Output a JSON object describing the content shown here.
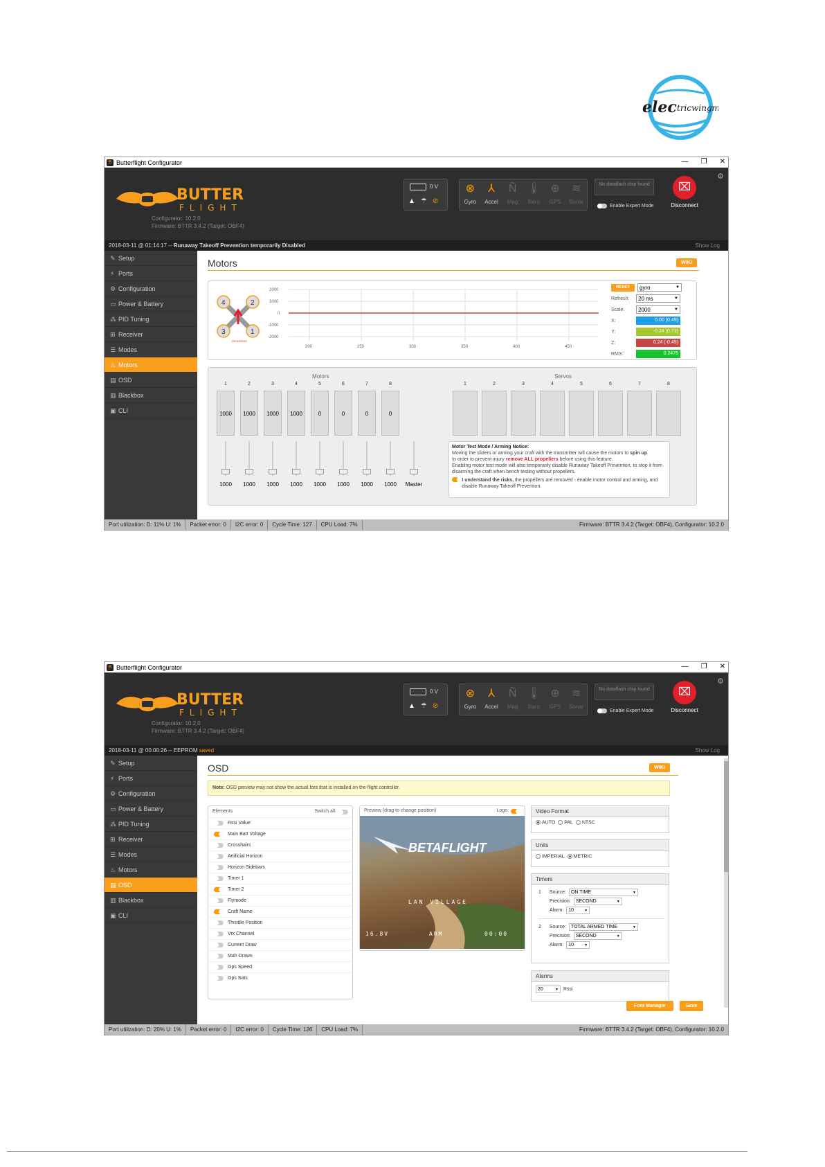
{
  "colors": {
    "accent": "#f89e1d",
    "header_bg": "#2d2d2d",
    "sidebar_bg": "#393939",
    "disconnect": "#e2202c",
    "x_bar": "#1e9ee8",
    "y_bar": "#a5c92b",
    "z_bar": "#c64545",
    "rms_bar": "#17c42b"
  },
  "brand_logo": "electricwingman",
  "app": {
    "title": "Butterflight Configurator",
    "brand_top": "BUTTER",
    "brand_bottom": "FLIGHT",
    "configurator": "Configurator: 10.2.0",
    "firmware": "Firmware: BTTR 3.4.2 (Target: OBF4)",
    "voltage": "0 V",
    "dataflash": "No dataflash chip found",
    "expert_mode": "Enable Expert Mode",
    "disconnect": "Disconnect",
    "show_log": "Show Log"
  },
  "sensors": [
    {
      "label": "Gyro",
      "icon": "gyro-icon",
      "on": true
    },
    {
      "label": "Accel",
      "icon": "accel-icon",
      "on": true
    },
    {
      "label": "Mag",
      "icon": "mag-icon",
      "on": false
    },
    {
      "label": "Baro",
      "icon": "baro-icon",
      "on": false
    },
    {
      "label": "GPS",
      "icon": "gps-icon",
      "on": false
    },
    {
      "label": "Sonar",
      "icon": "sonar-icon",
      "on": false
    }
  ],
  "sidebar": [
    "Setup",
    "Ports",
    "Configuration",
    "Power & Battery",
    "PID Tuning",
    "Receiver",
    "Modes",
    "Motors",
    "OSD",
    "Blackbox",
    "CLI"
  ],
  "status": {
    "port_util_1": "Port utilization: D: 11% U: 1%",
    "port_util_2": "Port utilization: D: 20% U: 1%",
    "packet_error": "Packet error: 0",
    "i2c_error": "I2C error: 0",
    "cycle_1": "Cycle Time: 127",
    "cycle_2": "Cycle Time: 126",
    "cpu": "CPU Load: 7%",
    "firmware": "Firmware: BTTR 3.4.2 (Target: OBF4), Configurator: 10.2.0"
  },
  "motors_screen": {
    "log_time": "2018-03-11 @ 01:14:17 --",
    "log_msg": "Runaway Takeoff Prevention temporarily Disabled",
    "title": "Motors",
    "wiki": "WIKI",
    "reversed": "REVERSED",
    "graph": {
      "y_ticks": [
        "2000",
        "1000",
        "0",
        "-1000",
        "-2000"
      ],
      "x_ticks": [
        "200",
        "250",
        "300",
        "350",
        "400",
        "450"
      ]
    },
    "controls": {
      "reset": "RESET",
      "sensor": "gyro",
      "refresh_label": "Refresh:",
      "refresh": "20 ms",
      "scale_label": "Scale:",
      "scale": "2000",
      "x_label": "X:",
      "x_val": "0.00 (0.49)",
      "y_label": "Y:",
      "y_val": "-0.24 (0.73)",
      "z_label": "Z:",
      "z_val": "0.24 (-0.49)",
      "rms_label": "RMS:",
      "rms_val": "0.2475"
    },
    "motors_header": "Motors",
    "servos_header": "Servos",
    "motor_nums": [
      "1",
      "2",
      "3",
      "4",
      "5",
      "6",
      "7",
      "8"
    ],
    "motor_vals": [
      "1000",
      "1000",
      "1000",
      "1000",
      "0",
      "0",
      "0",
      "0"
    ],
    "servo_nums": [
      "1",
      "2",
      "3",
      "4",
      "5",
      "6",
      "7",
      "8"
    ],
    "slider_vals": [
      "1000",
      "1000",
      "1000",
      "1000",
      "1000",
      "1000",
      "1000",
      "1000",
      "Master"
    ],
    "notice_title": "Motor Test Mode / Arming Notice:",
    "notice_l1a": "Moving the sliders or arming your craft with the transmitter will cause the motors to ",
    "notice_l1b": "spin up",
    "notice_l2a": "In order to prevent injury ",
    "notice_l2b": "remove ALL propellers",
    "notice_l2c": " before using this feature.",
    "notice_l3": "Enabling motor test mode will also temporarily disable Runaway Takeoff Prevention, to stop it from disarming the craft when bench testing without propellers.",
    "ack_b": "I understand the risks,",
    "ack_rest": " the propellers are removed - enable motor control and arming, and disable Runaway Takeoff Prevention."
  },
  "osd_screen": {
    "log_time": "2018-03-11 @ 00:00:26 -- EEPROM",
    "log_saved": "saved",
    "title": "OSD",
    "wiki": "WIKI",
    "note_b": "Note:",
    "note": " OSD preview may not show the actual font that is installed on the flight controller.",
    "elements_title": "Elements",
    "switch_all": "Switch all:",
    "elements": [
      {
        "label": "Rssi Value",
        "on": false
      },
      {
        "label": "Main Batt Voltage",
        "on": true
      },
      {
        "label": "Crosshairs",
        "on": false
      },
      {
        "label": "Artificial Horizon",
        "on": false
      },
      {
        "label": "Horizon Sidebars",
        "on": false
      },
      {
        "label": "Timer 1",
        "on": false
      },
      {
        "label": "Timer 2",
        "on": true
      },
      {
        "label": "Flymode",
        "on": false
      },
      {
        "label": "Craft Name",
        "on": true
      },
      {
        "label": "Throttle Position",
        "on": false
      },
      {
        "label": "Vtx Channel",
        "on": false
      },
      {
        "label": "Current Draw",
        "on": false
      },
      {
        "label": "Mah Drawn",
        "on": false
      },
      {
        "label": "Gps Speed",
        "on": false
      },
      {
        "label": "Gps Sats",
        "on": false
      }
    ],
    "preview_title": "Preview (drag to change position)",
    "logo_label": "Logo:",
    "osd_logo": "BETAFLIGHT",
    "osd_craft": "LAN VILLAGE",
    "osd_batt": "16.8V",
    "osd_arm": "ARM",
    "osd_timer": "00:00",
    "video_format": "Video Format",
    "vf_opts": [
      "AUTO",
      "PAL",
      "NTSC"
    ],
    "units": "Units",
    "unit_opts": [
      "IMPERIAL",
      "METRIC"
    ],
    "timers": "Timers",
    "t1": {
      "num": "1",
      "source_label": "Source:",
      "source": "ON TIME",
      "precision_label": "Precision:",
      "precision": "SECOND",
      "alarm_label": "Alarm:",
      "alarm": "10"
    },
    "t2": {
      "num": "2",
      "source_label": "Source:",
      "source": "TOTAL ARMED TIME",
      "precision_label": "Precision:",
      "precision": "SECOND",
      "alarm_label": "Alarm:",
      "alarm": "10"
    },
    "alarms": "Alarms",
    "alarm_rssi_val": "20",
    "alarm_rssi": "Rssi",
    "font_manager": "Font Manager",
    "save": "Save"
  }
}
